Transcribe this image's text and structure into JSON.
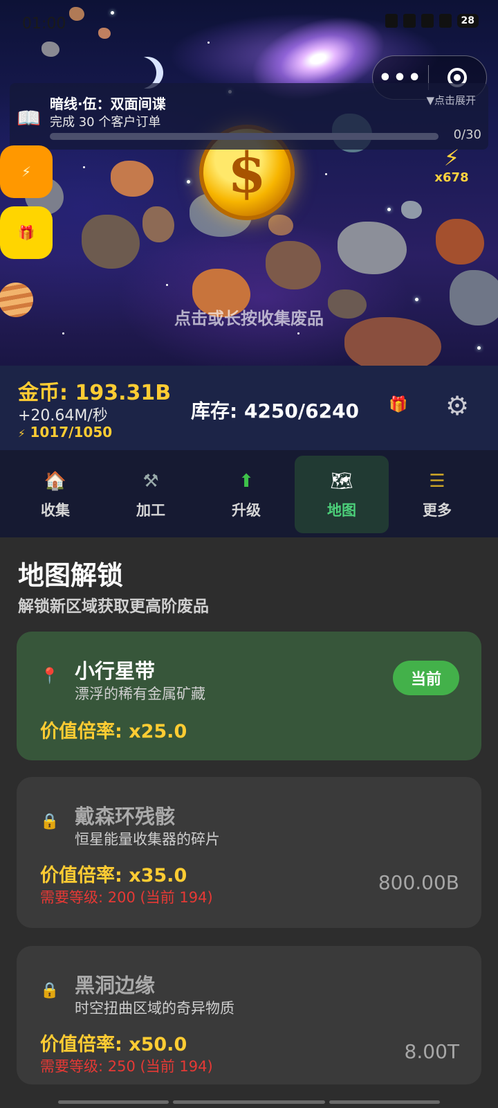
{
  "status_bar": {
    "time": "01:00",
    "battery": "28"
  },
  "capsule": {
    "more_label": "•••"
  },
  "scene": {
    "hint": "点击或长按收集废品"
  },
  "quest": {
    "title": "暗线·伍：双面间谍",
    "description": "完成 30 个客户订单",
    "expand_label": "▼点击展开",
    "progress_text": "0/30",
    "progress_fraction": 0.0
  },
  "side_buttons": {
    "energy_icon": "⚡",
    "gift_icon": "🎁"
  },
  "energy_badge": {
    "icon": "⚡",
    "multiplier": "x678"
  },
  "stats": {
    "gold": "金币: 193.31B",
    "rate": "+20.64M/秒",
    "energy_icon": "⚡",
    "energy": "1017/1050",
    "inventory": "库存: 4250/6240",
    "gift_icon": "🎁",
    "settings_icon": "⚙"
  },
  "tabs": [
    {
      "label": "收集",
      "icon": "🏠",
      "active": false
    },
    {
      "label": "加工",
      "icon": "⚒",
      "active": false
    },
    {
      "label": "升级",
      "icon": "⬆",
      "active": false
    },
    {
      "label": "地图",
      "icon": "🗺",
      "active": true
    },
    {
      "label": "更多",
      "icon": "☰",
      "active": false
    }
  ],
  "page": {
    "title": "地图解锁",
    "subtitle": "解锁新区域获取更高阶废品"
  },
  "areas": [
    {
      "name": "小行星带",
      "description": "漂浮的稀有金属矿藏",
      "multiplier": "价值倍率: x25.0",
      "status": "当前",
      "icon": "📍"
    },
    {
      "name": "戴森环残骸",
      "description": "恒星能量收集器的碎片",
      "multiplier": "价值倍率: x35.0",
      "requirement": "需要等级: 200 (当前 194)",
      "cost": "800.00B",
      "icon": "🔒"
    },
    {
      "name": "黑洞边缘",
      "description": "时空扭曲区域的奇异物质",
      "multiplier": "价值倍率: x50.0",
      "requirement": "需要等级: 250 (当前 194)",
      "cost": "8.00T",
      "icon": "🔒"
    }
  ],
  "colors": {
    "gold": "#ffcc33",
    "active_tab": "#4cd07a",
    "current_card": "#37563a",
    "current_badge": "#43b14a",
    "requirement": "#e53935"
  }
}
